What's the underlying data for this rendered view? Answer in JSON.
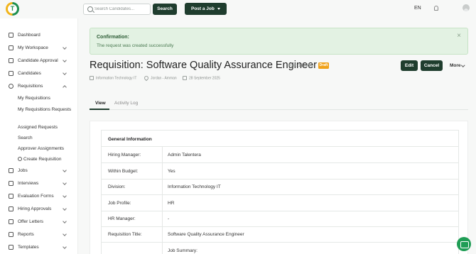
{
  "header": {
    "logo_letter": "T",
    "search_placeholder": "Search Candidates...",
    "search_button": "Search",
    "post_job_button": "Post a Job",
    "language": "EN"
  },
  "sidebar": {
    "items": [
      {
        "label": "Dashboard",
        "icon": "grid-icon"
      },
      {
        "label": "My Workspace",
        "icon": "laptop-icon"
      },
      {
        "label": "Candidate Approval",
        "icon": "user-check-icon"
      },
      {
        "label": "Candidates",
        "icon": "users-icon"
      },
      {
        "label": "Requisitions",
        "icon": "refresh-icon"
      },
      {
        "label": "Jobs",
        "icon": "briefcase-icon"
      },
      {
        "label": "Interviews",
        "icon": "calendar-icon"
      },
      {
        "label": "Evaluation Forms",
        "icon": "form-icon"
      },
      {
        "label": "Hiring Approvals",
        "icon": "approval-icon"
      },
      {
        "label": "Offer Letters",
        "icon": "document-icon"
      },
      {
        "label": "Reports",
        "icon": "chart-icon"
      },
      {
        "label": "Templates",
        "icon": "mail-icon"
      }
    ],
    "requisitions_sub": [
      "My Requisitions",
      "My Requisitions Requests",
      "Assigned Requests",
      "Search",
      "Approver Assignments",
      "Create Requisition"
    ]
  },
  "alert": {
    "title": "Confirmation:",
    "message": "The request was created successfully"
  },
  "requisition": {
    "title": "Requisition: Software Quality Assurance Engineer -",
    "ref": "Ref: 112450",
    "status": "Draft",
    "edit_button": "Edit",
    "cancel_button": "Cancel",
    "more_button": "More",
    "department": "Information Technology IT",
    "location": "Jordan - Amman",
    "date": "28 September 2025"
  },
  "tabs": [
    "View",
    "Activity Log"
  ],
  "general_info": {
    "heading": "General Information",
    "rows": [
      {
        "label": "Hiring Manager:",
        "value": "Admin Talentera"
      },
      {
        "label": "Within Budget:",
        "value": "Yes"
      },
      {
        "label": "Division:",
        "value": "Information Technology IT"
      },
      {
        "label": "Job Profile:",
        "value": "HR"
      },
      {
        "label": "HR Manager:",
        "value": "-"
      },
      {
        "label": "Requisition Title:",
        "value": "Software Quality Assurance Engineer"
      },
      {
        "label": "",
        "value": "Job Summary:"
      }
    ]
  },
  "colors": {
    "primary": "#1f3d2e",
    "alert_bg": "#e3f2e3",
    "draft_badge": "#f0a21a",
    "chat": "#1f9d55"
  }
}
